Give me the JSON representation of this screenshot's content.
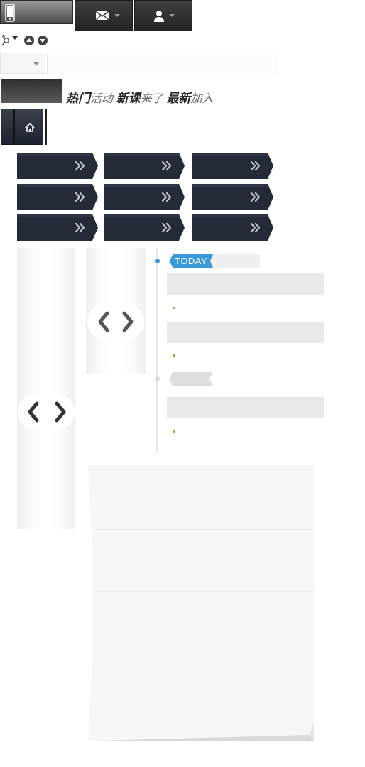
{
  "top_bar": {
    "phone_icon": "mobile-phone-icon",
    "mail_icon": "envelope-icon",
    "user_icon": "user-icon"
  },
  "toolbar_icons": [
    "search-icon",
    "caret-icon",
    "up-circle-icon",
    "down-circle-icon"
  ],
  "slogan": {
    "hot_bold": "热门",
    "hot_rest": "活动",
    "new_bold": "新课",
    "new_rest": "来了",
    "latest_bold": "最新",
    "latest_rest": "加入"
  },
  "home_tab": {
    "icon": "home-icon"
  },
  "grid_buttons": [
    {
      "icon": "double-chevron-right-icon"
    },
    {
      "icon": "double-chevron-right-icon"
    },
    {
      "icon": "double-chevron-right-icon"
    },
    {
      "icon": "double-chevron-right-icon"
    },
    {
      "icon": "double-chevron-right-icon"
    },
    {
      "icon": "double-chevron-right-icon"
    },
    {
      "icon": "double-chevron-right-icon"
    },
    {
      "icon": "double-chevron-right-icon"
    },
    {
      "icon": "double-chevron-right-icon"
    }
  ],
  "timeline": {
    "today_label": "TODAY"
  },
  "colors": {
    "dark_button": "#252a39",
    "today_blue": "#3a9ad9",
    "bullet_green": "#8ab43b"
  }
}
